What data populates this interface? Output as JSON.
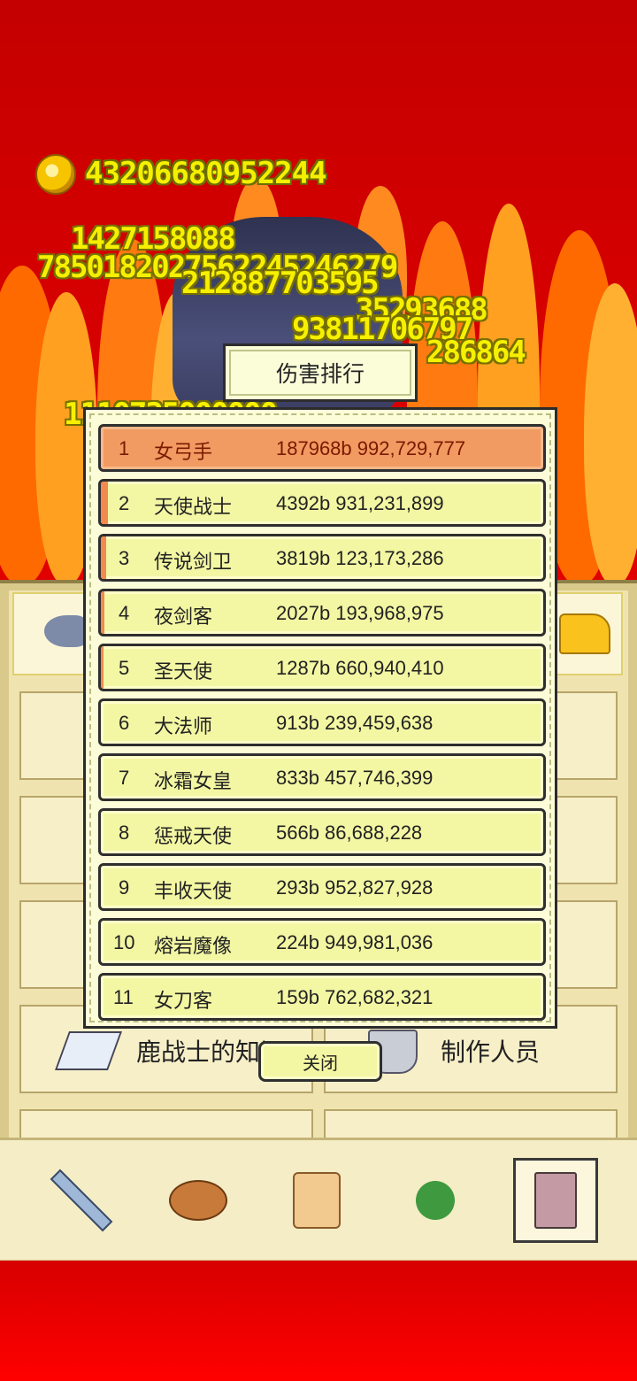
{
  "hud": {
    "gold": "43206680952244"
  },
  "damage_numbers": [
    "1427158088",
    "7850182027562245246279",
    "212887703595",
    "35293688",
    "93811706797",
    "286864",
    "1110735000000"
  ],
  "menu": {
    "tiles": [
      {
        "label": "鹿战士的知识"
      },
      {
        "label": "制作人员"
      }
    ]
  },
  "bottom_nav": [
    "sword-icon",
    "bread-icon",
    "scroll-icon",
    "clover-icon",
    "book-icon"
  ],
  "modal": {
    "title": "伤害排行",
    "close_label": "关闭",
    "rankings": [
      {
        "rank": "1",
        "name": "女弓手",
        "damage": "187968b 992,729,777"
      },
      {
        "rank": "2",
        "name": "天使战士",
        "damage": "4392b 931,231,899"
      },
      {
        "rank": "3",
        "name": "传说剑卫",
        "damage": "3819b 123,173,286"
      },
      {
        "rank": "4",
        "name": "夜剑客",
        "damage": "2027b 193,968,975"
      },
      {
        "rank": "5",
        "name": "圣天使",
        "damage": "1287b 660,940,410"
      },
      {
        "rank": "6",
        "name": "大法师",
        "damage": "913b 239,459,638"
      },
      {
        "rank": "7",
        "name": "冰霜女皇",
        "damage": "833b 457,746,399"
      },
      {
        "rank": "8",
        "name": "惩戒天使",
        "damage": "566b 86,688,228"
      },
      {
        "rank": "9",
        "name": "丰收天使",
        "damage": "293b 952,827,928"
      },
      {
        "rank": "10",
        "name": "熔岩魔像",
        "damage": "224b 949,981,036"
      },
      {
        "rank": "11",
        "name": "女刀客",
        "damage": "159b 762,682,321"
      }
    ]
  }
}
